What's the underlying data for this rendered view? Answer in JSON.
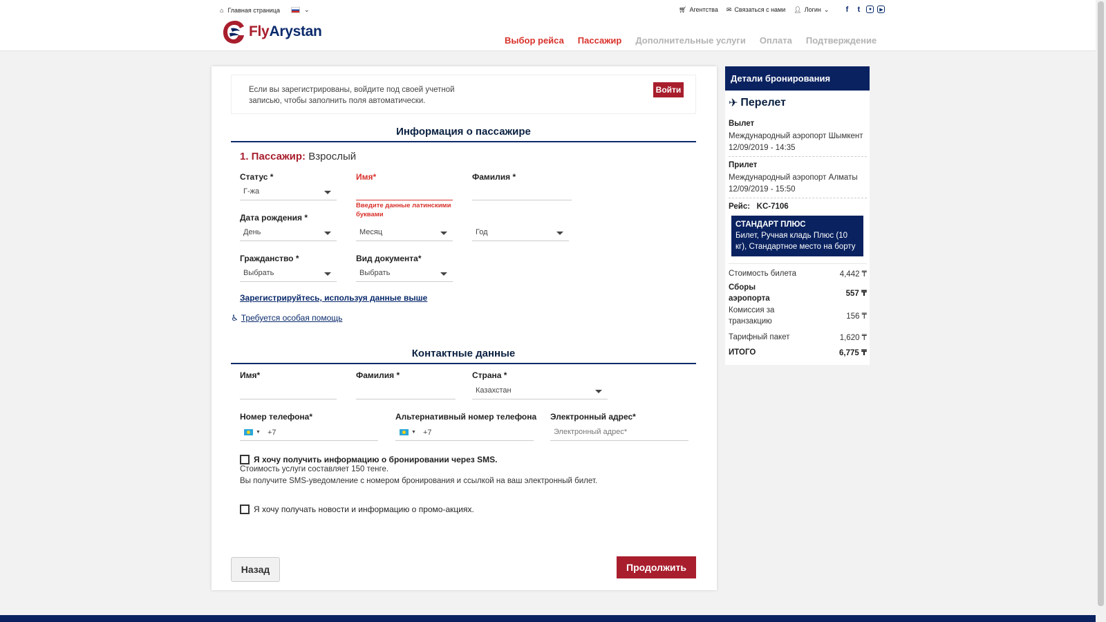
{
  "topnav": {
    "home": "Главная страница",
    "agencies": "Агентства",
    "contact": "Связаться с нами",
    "login": "Логин"
  },
  "brand": {
    "fly": "Fly",
    "arystan": "Arystan"
  },
  "steps": [
    "Выбор рейса",
    "Пассажир",
    "Дополнительные услуги",
    "Оплата",
    "Подтверждение"
  ],
  "login_box": {
    "text": "Если вы зарегистрированы, войдите под своей учетной записью, чтобы заполнить поля автоматически.",
    "button": "Войти"
  },
  "passenger": {
    "section_title": "Информация о пассажире",
    "heading_num": "1. Пассажир:",
    "heading_type": "Взрослый",
    "status_label": "Статус *",
    "status_value": "Г-жа",
    "first_name_label": "Имя*",
    "last_name_label": "Фамилия *",
    "first_name_error": "Введите данные латинскими буквами",
    "dob_label": "Дата рождения *",
    "day_value": "День",
    "month_value": "Месяц",
    "year_value": "Год",
    "citizenship_label": "Гражданство *",
    "citizenship_value": "Выбрать",
    "doc_type_label": "Вид документа*",
    "doc_type_value": "Выбрать",
    "register_link": "Зарегистрируйтесь, используя данные выше",
    "help_link": "Требуется особая помощь"
  },
  "contact": {
    "section_title": "Контактные данные",
    "first_name_label": "Имя*",
    "last_name_label": "Фамилия *",
    "country_label": "Страна *",
    "country_value": "Казахстан",
    "phone_label": "Номер телефона*",
    "phone_code": "+7",
    "alt_phone_label": "Альтернативный номер телефона",
    "alt_phone_code": "+7",
    "email_label": "Электронный адрес*",
    "email_placeholder": "Электронный адрес*",
    "sms_checkbox": "Я хочу получить информацию о бронировании через SMS.",
    "sms_cost": "Стоимость услуги составляет 150 тенге.",
    "sms_info": "Вы получите SMS-уведомление с номером бронирования и ссылкой на ваш электронный билет.",
    "promo_checkbox": "Я хочу получать новости и информацию о промо-акциях."
  },
  "buttons": {
    "back": "Назад",
    "next": "Продолжить"
  },
  "booking": {
    "title": "Детали бронирования",
    "flight_heading": "Перелет",
    "departure_label": "Вылет",
    "departure_airport": "Международный аэропорт Шымкент",
    "departure_time": "12/09/2019 - 14:35",
    "arrival_label": "Прилет",
    "arrival_airport": "Международный аэропорт Алматы",
    "arrival_time": "12/09/2019 - 15:50",
    "flight_label": "Рейс:",
    "flight_number": "KC-7106",
    "package_name": "СТАНДАРТ ПЛЮС",
    "package_desc": "Билет, Ручная кладь Плюс (10 кг), Стандартное место на борту",
    "prices": [
      {
        "name": "Стоимость билета",
        "value": "4,442 ₸",
        "bold": false
      },
      {
        "name": "Сборы аэропорта",
        "value": "557 ₸",
        "bold": true
      },
      {
        "name": "Комиссия за транзакцию",
        "value": "156 ₸",
        "bold": false
      },
      {
        "name": "Тарифный пакет",
        "value": "1,620 ₸",
        "bold": false
      },
      {
        "name": "ИТОГО",
        "value": "6,775 ₸",
        "bold": true
      }
    ]
  },
  "colors": {
    "brand_red": "#a81e2d",
    "brand_navy": "#0a2260",
    "step_active": "#d8312a",
    "step_inactive": "#b3b3b3"
  }
}
